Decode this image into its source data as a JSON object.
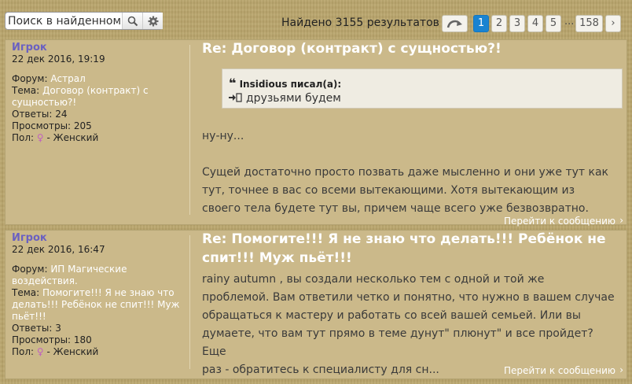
{
  "search": {
    "placeholder": "Поиск в найденном"
  },
  "results": {
    "found_text": "Найдено 3155 результатов"
  },
  "pagination": {
    "pages": [
      "1",
      "2",
      "3",
      "4",
      "5"
    ],
    "ellipsis": "...",
    "last": "158",
    "next": "›"
  },
  "posts": [
    {
      "author": "Игрок",
      "date": "22 дек 2016, 19:19",
      "forum_label": "Форум:",
      "forum": "Астрал",
      "topic_label": "Тема:",
      "topic_line1": "Договор (контракт) с",
      "topic_line2": "сущностью?!",
      "replies": "Ответы: 24",
      "views": "Просмотры: 205",
      "gender_label": "Пол:",
      "gender": "- Женский",
      "title": "Re: Договор (контракт) с сущностью?!",
      "quote_author": "Insidious писал(а):",
      "quote_text": "друзьями будем",
      "body": [
        "ну-ну...",
        "",
        "Сущей достаточно просто позвать даже мысленно и они уже тут как",
        "тут, точнее в вас со всеми вытекающими. Хотя вытекающим из",
        "своего тела будете тут вы, причем чаще всего уже безвозвратно."
      ],
      "goto": "Перейти к сообщению"
    },
    {
      "author": "Игрок",
      "date": "22 дек 2016, 16:47",
      "forum_label": "Форум:",
      "forum_line1": "ИП Магические",
      "forum_line2": "воздействия.",
      "topic_label": "Тема:",
      "topic_line1": "Помогите!!! Я не знаю что",
      "topic_line2": "делать!!! Ребёнок не спит!!! Муж",
      "topic_line3": "пьёт!!!",
      "replies": "Ответы: 3",
      "views": "Просмотры: 180",
      "gender_label": "Пол:",
      "gender": "- Женский",
      "title_line1": "Re: Помогите!!! Я не знаю что делать!!! Ребёнок не",
      "title_line2": "спит!!! Муж пьёт!!!",
      "body": [
        "rainy autumn , вы создали несколько тем с одной и той же",
        "проблемой. Вам ответили четко и понятно, что нужно в вашем случае",
        "обращаться к мастеру и работать со всей вашей семьей. Или вы",
        "думаете, что вам тут прямо в теме дунут\" плюнут\" и все пройдет? Еще",
        "раз - обратитесь к специалисту для сн..."
      ],
      "goto": "Перейти к сообщению"
    }
  ]
}
